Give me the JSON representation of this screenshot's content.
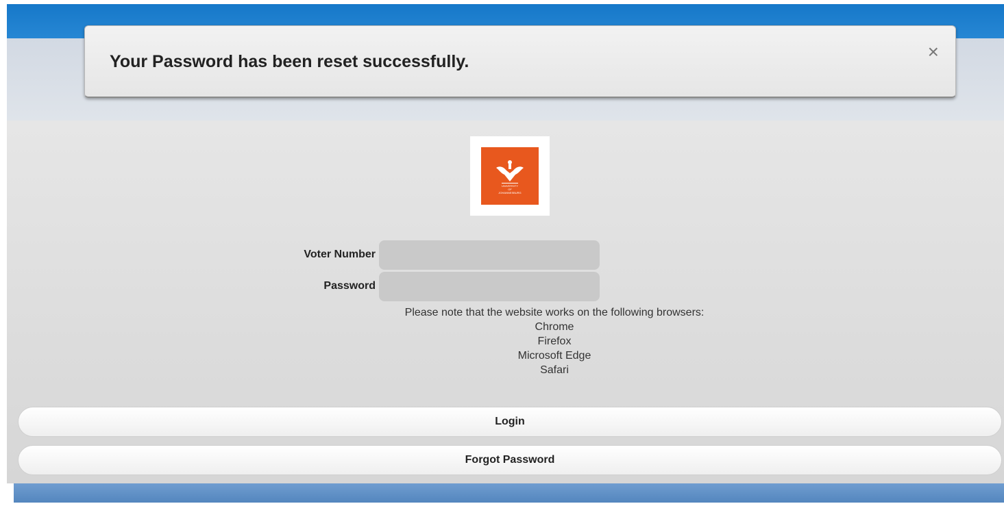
{
  "notification": {
    "message": "Your Password has been reset successfully.",
    "close_glyph": "×"
  },
  "logo": {
    "line1": "UNIVERSITY",
    "line2": "OF",
    "line3": "JOHANNESBURG",
    "color": "#e8581e"
  },
  "form": {
    "voter_number_label": "Voter Number",
    "voter_number_value": "",
    "password_label": "Password",
    "password_value": ""
  },
  "browser_note": {
    "intro": "Please note that the website works on the following browsers:",
    "browsers": [
      "Chrome",
      "Firefox",
      "Microsoft Edge",
      "Safari"
    ]
  },
  "buttons": {
    "login": "Login",
    "forgot_password": "Forgot Password"
  }
}
